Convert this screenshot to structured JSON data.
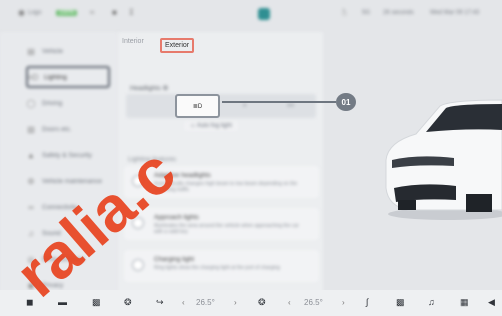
{
  "statusbar": {
    "items": [
      {
        "text": "Logo",
        "icon": "lock-icon"
      },
      {
        "text": "100%",
        "badge": true
      },
      {
        "text": "",
        "icon": "wifi-icon"
      },
      {
        "text": "",
        "icon": "folder-icon"
      },
      {
        "text": "",
        "icon": "download-icon"
      }
    ],
    "right": [
      {
        "text": "",
        "icon": "bluetooth-icon"
      },
      {
        "text": "5G",
        "icon": "signal-icon"
      },
      {
        "text": "26 seconds",
        "icon": "clock-icon"
      },
      {
        "text": "Wed Mar 09 17:43",
        "icon": "calendar-icon"
      }
    ]
  },
  "sidebar": {
    "items": [
      {
        "label": "Vehicle",
        "icon": "car-icon"
      },
      {
        "label": "Lighting",
        "icon": "headlight-icon"
      },
      {
        "label": "Driving",
        "icon": "steering-icon"
      },
      {
        "label": "Doors etc.",
        "icon": "door-icon"
      },
      {
        "label": "Safety & Security",
        "icon": "shield-icon"
      },
      {
        "label": "Vehicle maintenance",
        "icon": "wrench-icon"
      },
      {
        "label": "Connectivity",
        "icon": "link-icon"
      },
      {
        "label": "Sound",
        "icon": "speaker-icon"
      },
      {
        "label": "Drive assistant",
        "icon": "assist-icon"
      },
      {
        "label": "Privacy",
        "icon": "lock-icon"
      }
    ]
  },
  "tabs": [
    {
      "label": "Interior"
    },
    {
      "label": "Exterior"
    }
  ],
  "headlights": {
    "label": "Headlights ⚙",
    "options": [
      "",
      "≣D",
      "≡",
      "≡≡"
    ],
    "selected_index": 1,
    "auto_label": "Auto fog light"
  },
  "lighting_section_label": "Lighting features",
  "cards": [
    {
      "title": "Adaptive headlights",
      "desc": "Automatically changes high beam to low beam depending on the oncoming traffic"
    },
    {
      "title": "Approach lights",
      "desc": "Illuminates the area around the vehicle when approaching the car with a valid key"
    },
    {
      "title": "Charging light",
      "desc": "Ring lights show the charging light at the port of charging"
    }
  ],
  "callout": {
    "number": "01"
  },
  "dock": {
    "left_temp": "26.5°",
    "right_temp": "26.5°",
    "icons": [
      "home-icon",
      "car-icon",
      "seat-icon",
      "fan-icon",
      "phone-icon",
      "fan-icon",
      "seat-heat-icon",
      "music-icon",
      "apps-icon",
      "volume-icon"
    ]
  },
  "watermark": {
    "text": "ralia.c"
  },
  "colors": {
    "accent": "#e8431f",
    "callout": "#737b85",
    "background": "#e4e6e9"
  }
}
